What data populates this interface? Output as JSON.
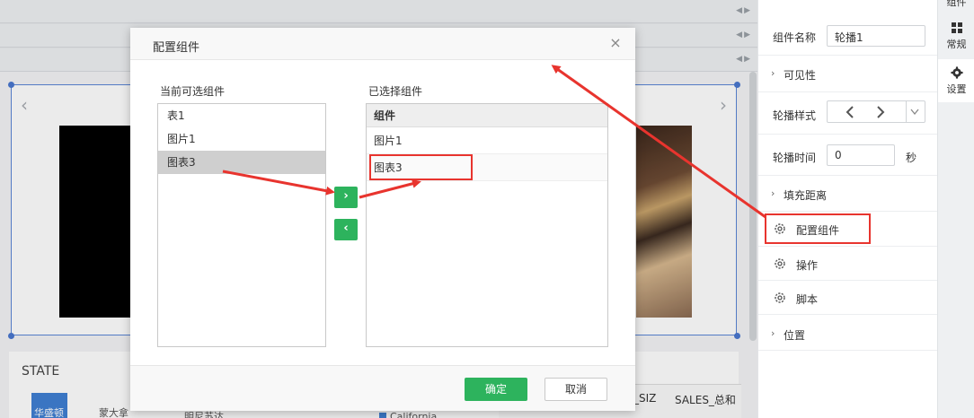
{
  "dialog": {
    "title": "配置组件",
    "available_label": "当前可选组件",
    "selected_label": "已选择组件",
    "available_items": [
      "表1",
      "图片1",
      "图表3"
    ],
    "selected_header": "组件",
    "selected_items": [
      "图片1",
      "图表3"
    ],
    "move_right_symbol": "›",
    "move_left_symbol": "‹",
    "ok_label": "确定",
    "cancel_label": "取消",
    "close_symbol": "×"
  },
  "properties": {
    "name_label": "组件名称",
    "name_value": "轮播1",
    "visibility_label": "可见性",
    "style_label": "轮播样式",
    "time_label": "轮播时间",
    "time_value": "0",
    "time_unit": "秒",
    "padding_label": "填充距离",
    "config_label": "配置组件",
    "operation_label": "操作",
    "script_label": "脚本",
    "position_label": "位置"
  },
  "tabs": {
    "top_partial": "组件",
    "general": "常规",
    "settings": "设置"
  },
  "background": {
    "state_title": "STATE",
    "map_label_1": "华盛顿",
    "map_label_2": "蒙大拿",
    "map_label_3": "明尼苏达",
    "legend_item": "California",
    "col_1": "_SIZ",
    "col_2": "SALES_总和"
  },
  "colors": {
    "accent_green": "#2db35d",
    "annotation_red": "#e8342e",
    "selection_blue": "#4a78d0"
  }
}
